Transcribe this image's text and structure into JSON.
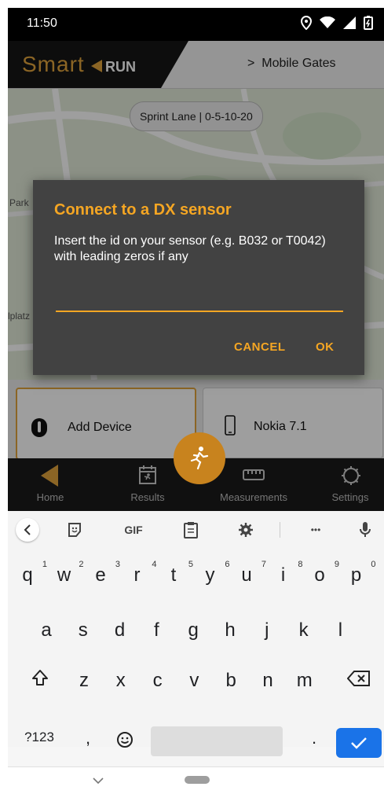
{
  "status_bar": {
    "time": "11:50"
  },
  "header": {
    "logo_smart": "Smart",
    "logo_run": "RUN",
    "gates_label": "Mobile Gates",
    "gates_chevron": ">"
  },
  "map": {
    "sprint_chip": "Sprint Lane | 0-5-10-20",
    "label_park": "Park",
    "label_platz": "lplatz"
  },
  "dialog": {
    "title": "Connect to a DX sensor",
    "message": "Insert the id on your sensor (e.g. B032 or T0042) with leading zeros if any",
    "input_value": "",
    "cancel_label": "CANCEL",
    "ok_label": "OK"
  },
  "devices": [
    {
      "label": "Add Device"
    },
    {
      "label": "Nokia 7.1"
    }
  ],
  "bottom_nav": {
    "items": [
      {
        "label": "Home"
      },
      {
        "label": "Results"
      },
      {
        "label": "Measurements"
      },
      {
        "label": "Settings"
      }
    ]
  },
  "keyboard": {
    "gif_label": "GIF",
    "more_label": "•••",
    "row1": [
      {
        "k": "q",
        "h": "1"
      },
      {
        "k": "w",
        "h": "2"
      },
      {
        "k": "e",
        "h": "3"
      },
      {
        "k": "r",
        "h": "4"
      },
      {
        "k": "t",
        "h": "5"
      },
      {
        "k": "y",
        "h": "6"
      },
      {
        "k": "u",
        "h": "7"
      },
      {
        "k": "i",
        "h": "8"
      },
      {
        "k": "o",
        "h": "9"
      },
      {
        "k": "p",
        "h": "0"
      }
    ],
    "row2": [
      "a",
      "s",
      "d",
      "f",
      "g",
      "h",
      "j",
      "k",
      "l"
    ],
    "row3": [
      "z",
      "x",
      "c",
      "v",
      "b",
      "n",
      "m"
    ],
    "sym_label": "?123",
    "comma": ",",
    "period": "."
  },
  "colors": {
    "accent": "#f5a623",
    "dialog_bg": "#424242",
    "nav_bg": "#1b1b1b",
    "enter": "#1a73e8"
  }
}
